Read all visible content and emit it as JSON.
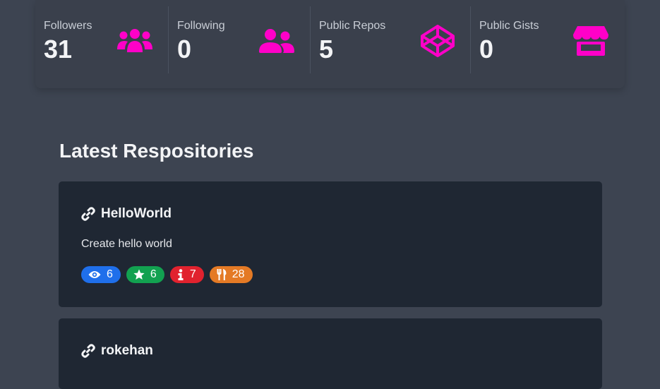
{
  "stats": [
    {
      "title": "Followers",
      "value": "31",
      "icon": "users-icon"
    },
    {
      "title": "Following",
      "value": "0",
      "icon": "user-friends-icon"
    },
    {
      "title": "Public Repos",
      "value": "5",
      "icon": "codepen-icon"
    },
    {
      "title": "Public Gists",
      "value": "0",
      "icon": "store-icon"
    }
  ],
  "accent_color": "#ff00c8",
  "section": {
    "title": "Latest Respositories"
  },
  "repos": [
    {
      "name": "HelloWorld",
      "description": "Create hello world",
      "badges": {
        "watchers": "6",
        "stars": "6",
        "issues": "7",
        "forks": "28"
      }
    },
    {
      "name": "rokehan"
    }
  ],
  "badge_colors": {
    "watchers": "#1f6feb",
    "stars": "#12a150",
    "issues": "#e1222e",
    "forks": "#e47a25"
  }
}
